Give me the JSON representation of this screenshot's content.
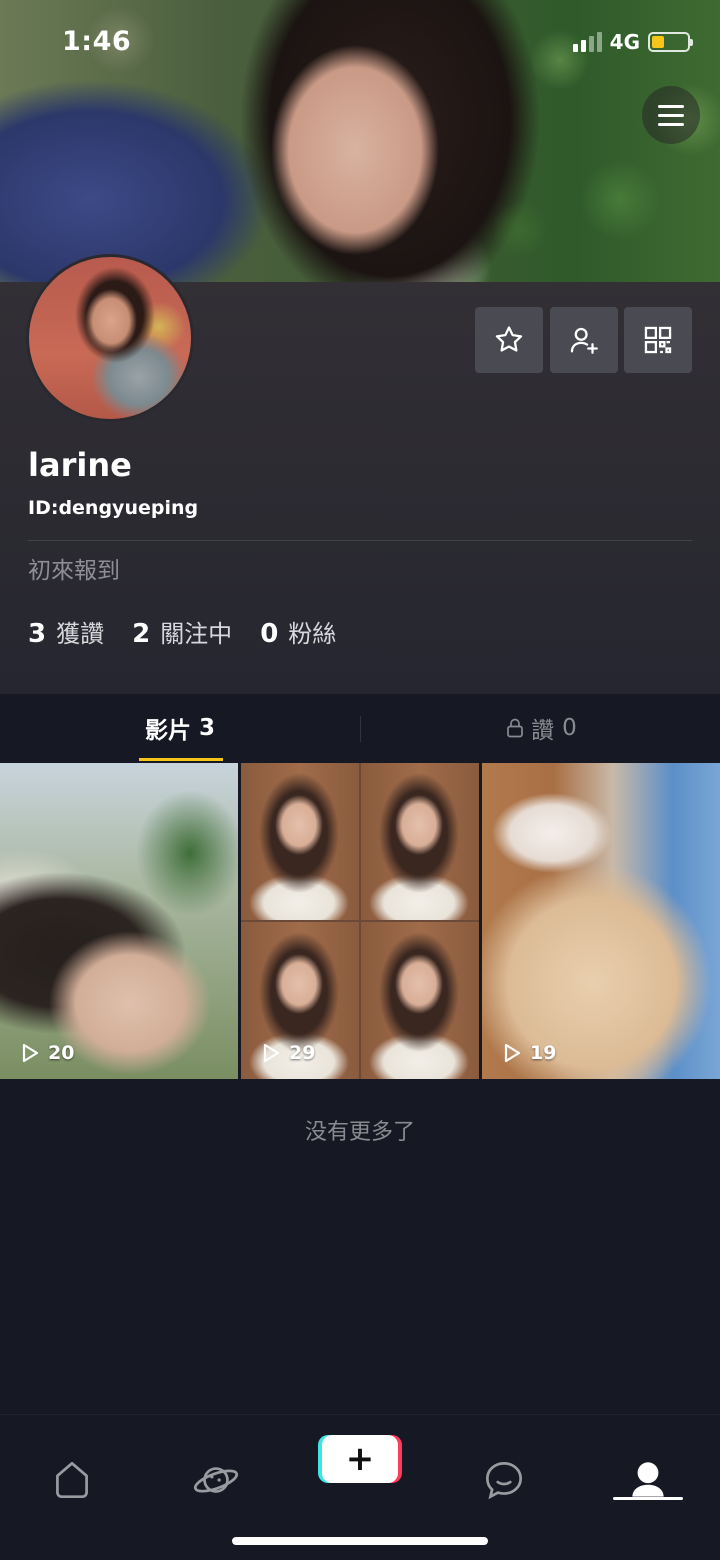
{
  "status_bar": {
    "time": "1:46",
    "network": "4G",
    "battery_level": 0.35
  },
  "profile": {
    "username": "larine",
    "id": "ID:dengyueping",
    "bio": "初來報到",
    "stats": [
      {
        "value": "3",
        "label": "獲讚"
      },
      {
        "value": "2",
        "label": "關注中"
      },
      {
        "value": "0",
        "label": "粉絲"
      }
    ]
  },
  "tabs": {
    "videos": {
      "label": "影片",
      "count": "3"
    },
    "likes": {
      "label": "讚",
      "count": "0"
    }
  },
  "videos": [
    {
      "views": "20"
    },
    {
      "views": "29"
    },
    {
      "views": "19"
    }
  ],
  "no_more_text": "没有更多了",
  "colors": {
    "accent": "#f5c518",
    "background": "#161823"
  },
  "nav": {
    "items": [
      "home-icon",
      "discover-planet-icon",
      "create-plus-icon",
      "message-icon",
      "profile-icon"
    ],
    "create_label": "+",
    "active": "profile"
  }
}
